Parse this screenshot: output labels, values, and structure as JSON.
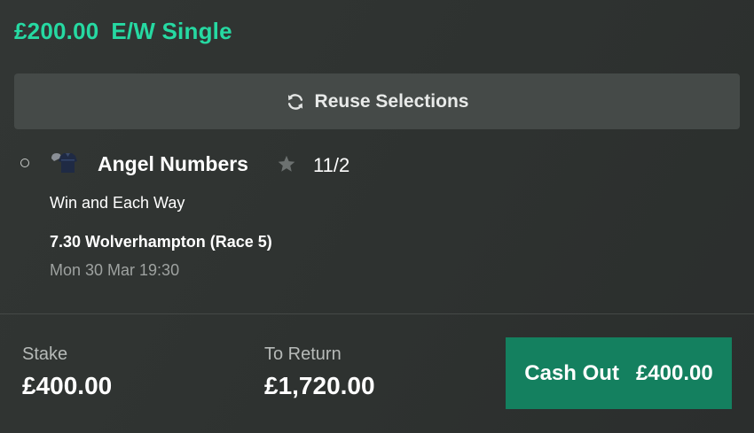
{
  "bet": {
    "amount": "£200.00",
    "type": "E/W Single"
  },
  "reuse": {
    "label": "Reuse Selections",
    "icon": "refresh-icon"
  },
  "selection": {
    "horse_name": "Angel Numbers",
    "odds": "11/2",
    "market": "Win and Each Way",
    "event": "7.30 Wolverhampton (Race 5)",
    "event_time": "Mon 30 Mar 19:30",
    "icons": [
      "status-circle-icon",
      "jockey-silks-icon",
      "star-icon"
    ]
  },
  "summary": {
    "stake_label": "Stake",
    "stake_value": "£400.00",
    "return_label": "To Return",
    "return_value": "£1,720.00"
  },
  "cashout": {
    "label": "Cash Out",
    "value": "£400.00"
  },
  "colors": {
    "accent": "#26d9a2",
    "cashout_bg": "#14805f",
    "button_bg": "#454a48",
    "background": "#2f3331"
  }
}
